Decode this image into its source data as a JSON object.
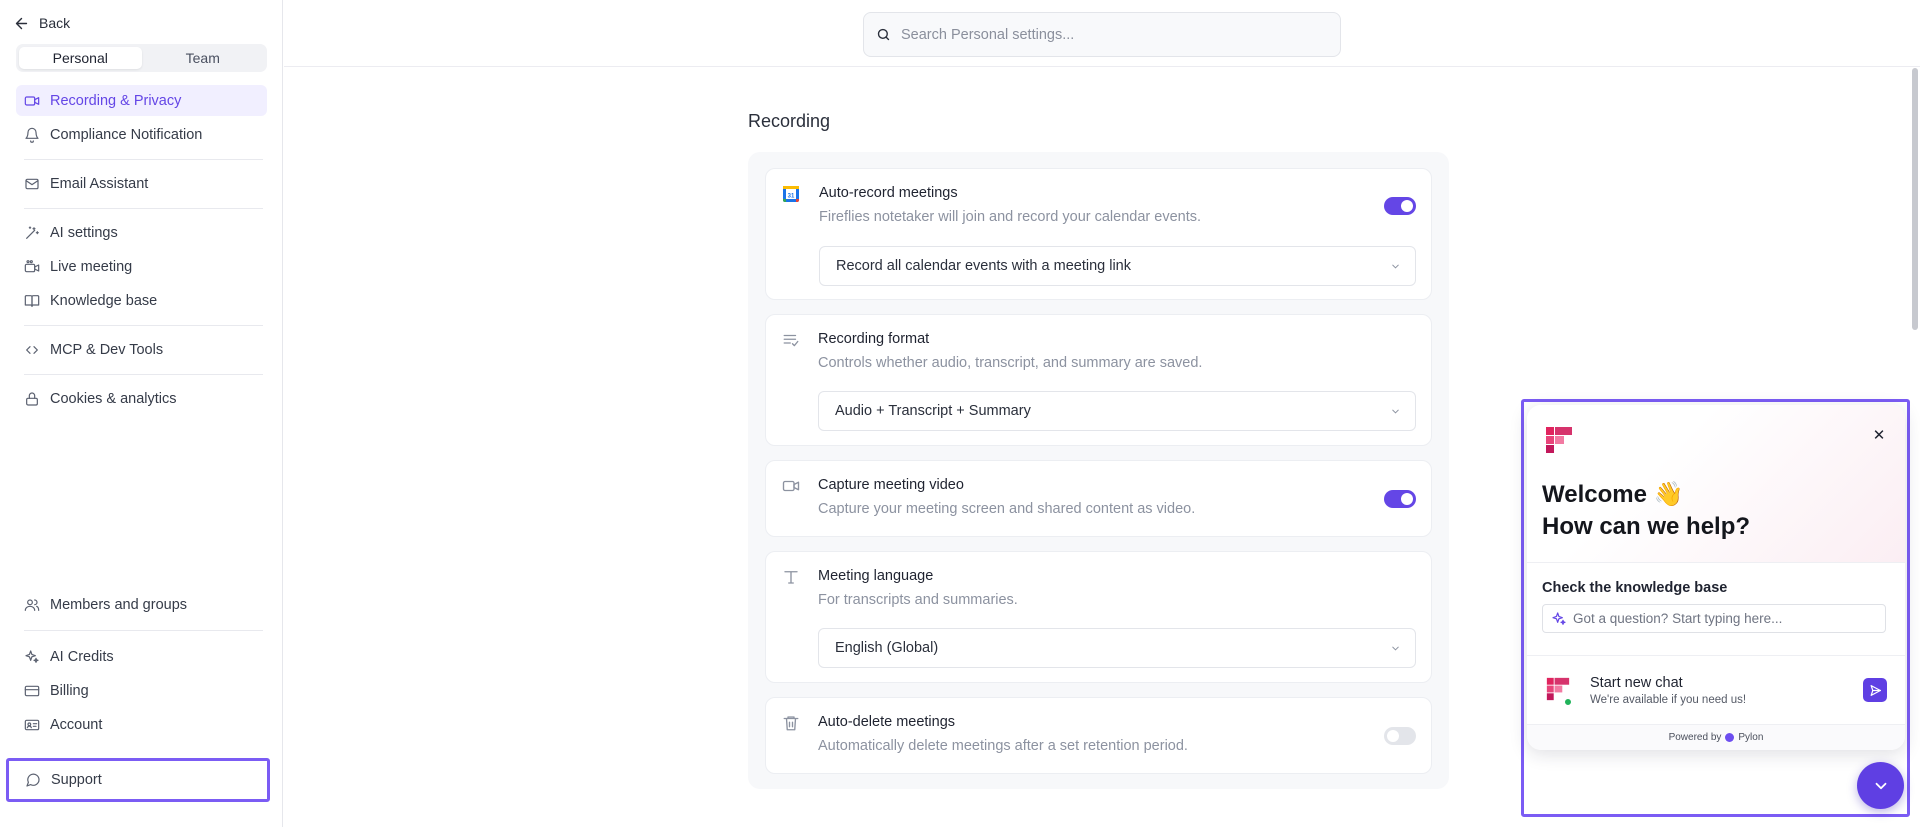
{
  "sidebar": {
    "back_label": "Back",
    "tabs": [
      {
        "label": "Personal",
        "active": true
      },
      {
        "label": "Team",
        "active": false
      }
    ],
    "items": [
      {
        "label": "Recording & Privacy",
        "icon": "video-icon",
        "active": true
      },
      {
        "label": "Compliance Notification",
        "icon": "bell-icon"
      },
      {
        "label": "Email Assistant",
        "icon": "mail-icon"
      },
      {
        "label": "AI settings",
        "icon": "wand-icon"
      },
      {
        "label": "Live meeting",
        "icon": "live-video-icon"
      },
      {
        "label": "Knowledge base",
        "icon": "book-icon"
      },
      {
        "label": "MCP & Dev Tools",
        "icon": "code-icon"
      },
      {
        "label": "Cookies & analytics",
        "icon": "lock-icon"
      },
      {
        "label": "Members and groups",
        "icon": "users-icon"
      },
      {
        "label": "AI Credits",
        "icon": "sparkles-icon"
      },
      {
        "label": "Billing",
        "icon": "card-icon"
      },
      {
        "label": "Account",
        "icon": "id-card-icon"
      }
    ],
    "support_label": "Support"
  },
  "search": {
    "placeholder": "Search Personal settings..."
  },
  "main": {
    "section_title": "Recording",
    "cards": [
      {
        "title": "Auto-record meetings",
        "description": "Fireflies notetaker will join and record your calendar events.",
        "toggle": true,
        "select_value": "Record all calendar events with a meeting link",
        "icon": "calendar-icon"
      },
      {
        "title": "Recording format",
        "description": "Controls whether audio, transcript, and summary are saved.",
        "select_value": "Audio + Transcript + Summary",
        "icon": "list-check-icon"
      },
      {
        "title": "Capture meeting video",
        "description": "Capture your meeting screen and shared content as video.",
        "toggle": true,
        "icon": "camera-icon"
      },
      {
        "title": "Meeting language",
        "description": "For transcripts and summaries.",
        "select_value": "English (Global)",
        "icon": "type-icon"
      },
      {
        "title": "Auto-delete meetings",
        "description": "Automatically delete meetings after a set retention period.",
        "toggle": false,
        "icon": "trash-icon"
      }
    ]
  },
  "widget": {
    "welcome_line1": "Welcome 👋",
    "welcome_line2": "How can we help?",
    "kb_title": "Check the knowledge base",
    "kb_placeholder": "Got a question? Start typing here...",
    "chat_title": "Start new chat",
    "chat_subtitle": "We're available if you need us!",
    "powered_prefix": "Powered by",
    "powered_brand": "Pylon"
  },
  "colors": {
    "accent": "#6446e6",
    "highlight_border": "#7b5cf4",
    "brand_pink": "#d6336c"
  }
}
